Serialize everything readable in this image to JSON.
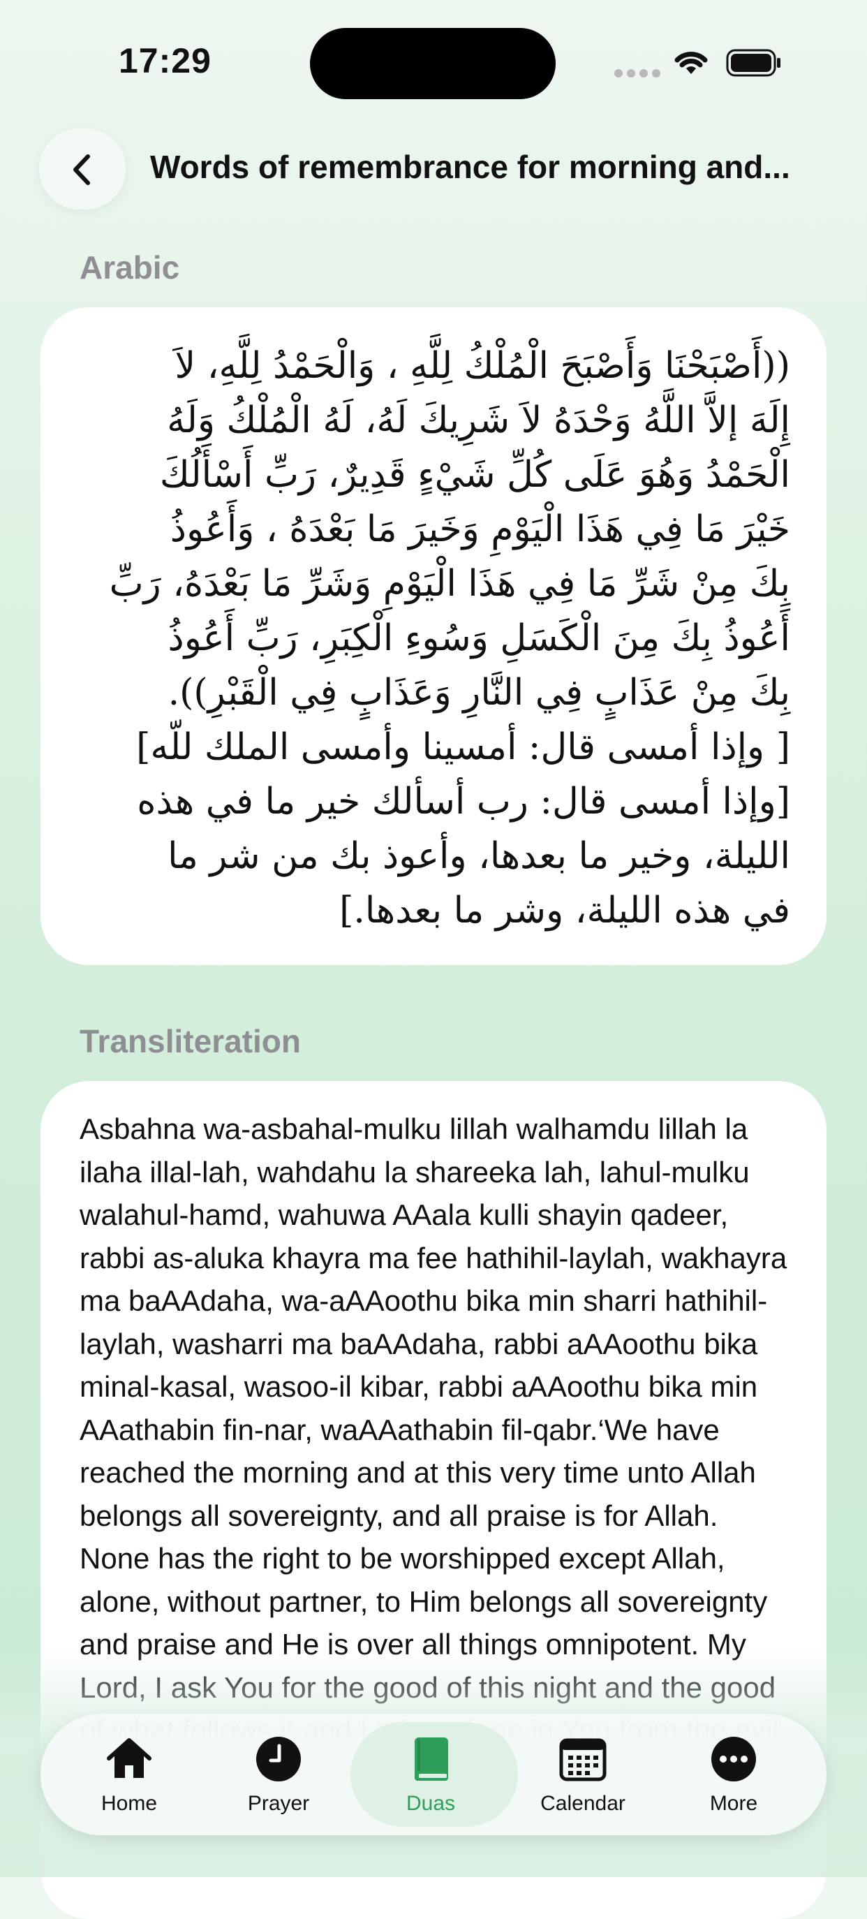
{
  "status_bar": {
    "time": "17:29"
  },
  "header": {
    "title": "Words of remembrance for morning and..."
  },
  "sections": {
    "arabic_label": "Arabic",
    "arabic_text": "((أَصْبَحْنَا وَأَصْبَحَ الْمُلْكُ لِلَّهِ ، وَالْحَمْدُ لِلَّهِ، لاَ\nإِلَهَ إلاَّ اللَّهُ وَحْدَهُ لاَ شَرِيكَ لَهُ، لَهُ الْمُلْكُ وَلَهُ\nالْحَمْدُ وَهُوَ عَلَى كُلِّ شَيْءٍ قَدِيرٌ، رَبِّ أَسْأَلُكَ\nخَيْرَ مَا فِي هَذَا الْيَوْمِ وَخَيرَ مَا بَعْدَهُ ، وَأَعُوذُ\nبِكَ مِنْ شَرِّ مَا فِي هَذَا الْيَوْمِ وَشَرِّ مَا بَعْدَهُ، رَبِّ\nأَعُوذُ بِكَ مِنَ الْكَسَلِ وَسُوءِ الْكِبَرِ، رَبِّ أَعُوذُ\nبِكَ مِنْ عَذَابٍ فِي النَّارِ وَعَذَابٍ فِي الْقَبْرِ)).\n[ وإذا أمسى قال: أمسينا وأمسى الملك للّه]\n[وإذا أمسى قال: رب أسألك خير ما في هذه\nالليلة، وخير ما بعدها، وأعوذ بك من شر ما\nفي هذه الليلة، وشر ما بعدها.]",
    "translit_label": "Transliteration",
    "translit_text": "Asbahna wa-asbahal-mulku lillah walhamdu lillah la ilaha illal-lah, wahdahu la shareeka lah, lahul-mulku walahul-hamd, wahuwa AAala kulli shayin qadeer, rabbi as-aluka khayra ma fee hathihil-laylah, wakhayra ma baAAdaha, wa-aAAoothu bika min sharri hathihil-laylah, washarri ma baAAdaha, rabbi aAAoothu bika minal-kasal, wasoo-il kibar, rabbi aAAoothu bika min AAathabin fin-nar, waAAathabin fil-qabr.‘We have reached the morning and at this very time unto Allah belongs all sovereignty, and all praise is for Allah. None has the right to be worshipped except Allah, alone, without partner, to Him belongs all sovereignty and praise and He is over all things omnipotent. My Lord, I ask You for the good of this night and the good of what follows it and I take refuge in You from the evil of this night and the evil of"
  },
  "tabbar": {
    "tabs": [
      {
        "label": "Home",
        "icon": "home-icon"
      },
      {
        "label": "Prayer",
        "icon": "clock-icon"
      },
      {
        "label": "Duas",
        "icon": "book-icon"
      },
      {
        "label": "Calendar",
        "icon": "calendar-icon"
      },
      {
        "label": "More",
        "icon": "more-icon"
      }
    ],
    "active": "Duas",
    "accent_color": "#2e9e5b"
  }
}
